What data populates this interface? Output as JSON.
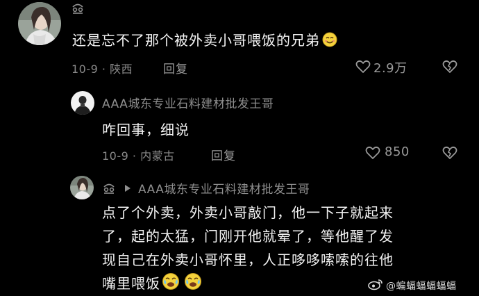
{
  "comments": [
    {
      "username": "",
      "text": "还是忘不了那个被外卖小哥喂饭的兄弟",
      "date": "10-9",
      "location": "陕西",
      "reply_label": "回复",
      "likes": "2.9万"
    },
    {
      "username": "AAA城东专业石料建材批发王哥",
      "text": "咋回事，细说",
      "date": "10-9",
      "location": "内蒙古",
      "reply_label": "回复",
      "likes": "850"
    },
    {
      "username": "",
      "reply_to": "AAA城东专业石料建材批发王哥",
      "lines": [
        "点了个外卖，外卖小哥敲门，他一下子就起来",
        "了，起的太猛，门刚开他就晕了，等他醒了发",
        "现自己在外卖小哥怀里，人正哆哆嗦嗦的往他",
        "嘴里喂饭"
      ]
    }
  ],
  "watermark": {
    "text": "@蝙蝠蝠蝠蝠蝠"
  },
  "colors": {
    "background": "#000000",
    "text": "#f2f2f2",
    "secondary": "#8e8e8e"
  }
}
